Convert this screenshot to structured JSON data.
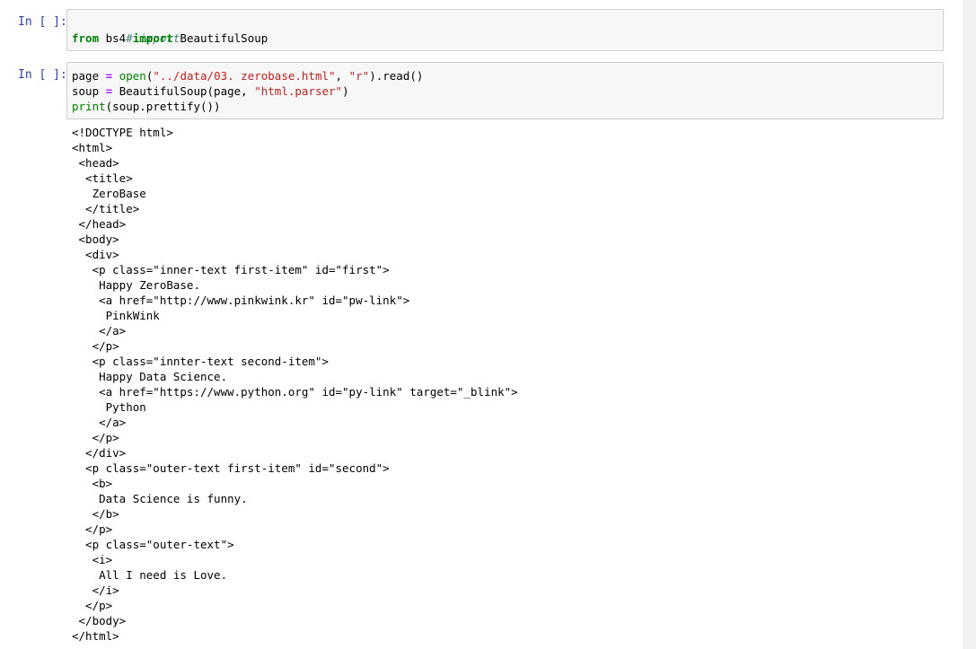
{
  "cells": [
    {
      "prompt": "In [ ]:",
      "lines": [
        {
          "comment": "# import"
        },
        {
          "kw1": "from",
          "t1": " bs4 ",
          "kw2": "import",
          "t2": " BeautifulSoup"
        }
      ]
    },
    {
      "prompt": "In [ ]:",
      "lines": [
        {
          "a": "page ",
          "eq": "=",
          "b": " ",
          "fn": "open",
          "c": "(",
          "s1": "\"../data/03. zerobase.html\"",
          "d": ", ",
          "s2": "\"r\"",
          "e": ").read()"
        },
        {
          "a": "soup ",
          "eq": "=",
          "b": " BeautifulSoup(page, ",
          "s1": "\"html.parser\"",
          "e": ")"
        },
        {
          "fn": "print",
          "e": "(soup.prettify())"
        }
      ]
    }
  ],
  "output_lines": [
    "<!DOCTYPE html>",
    "<html>",
    " <head>",
    "  <title>",
    "   ZeroBase",
    "  </title>",
    " </head>",
    " <body>",
    "  <div>",
    "   <p class=\"inner-text first-item\" id=\"first\">",
    "    Happy ZeroBase.",
    "    <a href=\"http://www.pinkwink.kr\" id=\"pw-link\">",
    "     PinkWink",
    "    </a>",
    "   </p>",
    "   <p class=\"innter-text second-item\">",
    "    Happy Data Science.",
    "    <a href=\"https://www.python.org\" id=\"py-link\" target=\"_blink\">",
    "     Python",
    "    </a>",
    "   </p>",
    "  </div>",
    "  <p class=\"outer-text first-item\" id=\"second\">",
    "   <b>",
    "    Data Science is funny.",
    "   </b>",
    "  </p>",
    "  <p class=\"outer-text\">",
    "   <i>",
    "    All I need is Love.",
    "   </i>",
    "  </p>",
    " </body>",
    "</html>"
  ]
}
